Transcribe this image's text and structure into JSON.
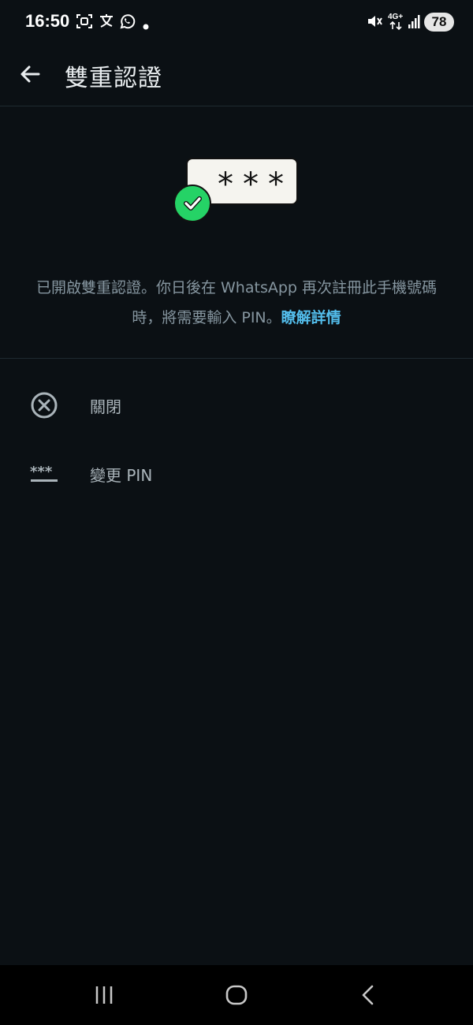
{
  "status_bar": {
    "time": "16:50",
    "battery": "78",
    "network": "4G+",
    "left_icons": [
      "screenshot-icon",
      "translate-icon",
      "whatsapp-icon",
      "dot-icon"
    ],
    "right_icons": [
      "mute-icon",
      "network-4g-icon",
      "signal-icon",
      "battery-icon"
    ]
  },
  "app_bar": {
    "title": "雙重認證",
    "back_icon": "arrow-left-icon"
  },
  "illustration": {
    "pin_mask": "***",
    "check_color": "#25d366"
  },
  "description": {
    "text": "已開啟雙重認證。你日後在 WhatsApp 再次註冊此手機號碼時，將需要輸入 PIN。",
    "link": "瞭解詳情",
    "link_color": "#53bdeb"
  },
  "options": [
    {
      "label": "關閉",
      "icon": "close-circle-icon"
    },
    {
      "label": "變更 PIN",
      "icon": "pin-asterisk-icon"
    }
  ],
  "nav_bar": {
    "items": [
      "recent-apps-icon",
      "home-icon",
      "back-icon"
    ]
  }
}
